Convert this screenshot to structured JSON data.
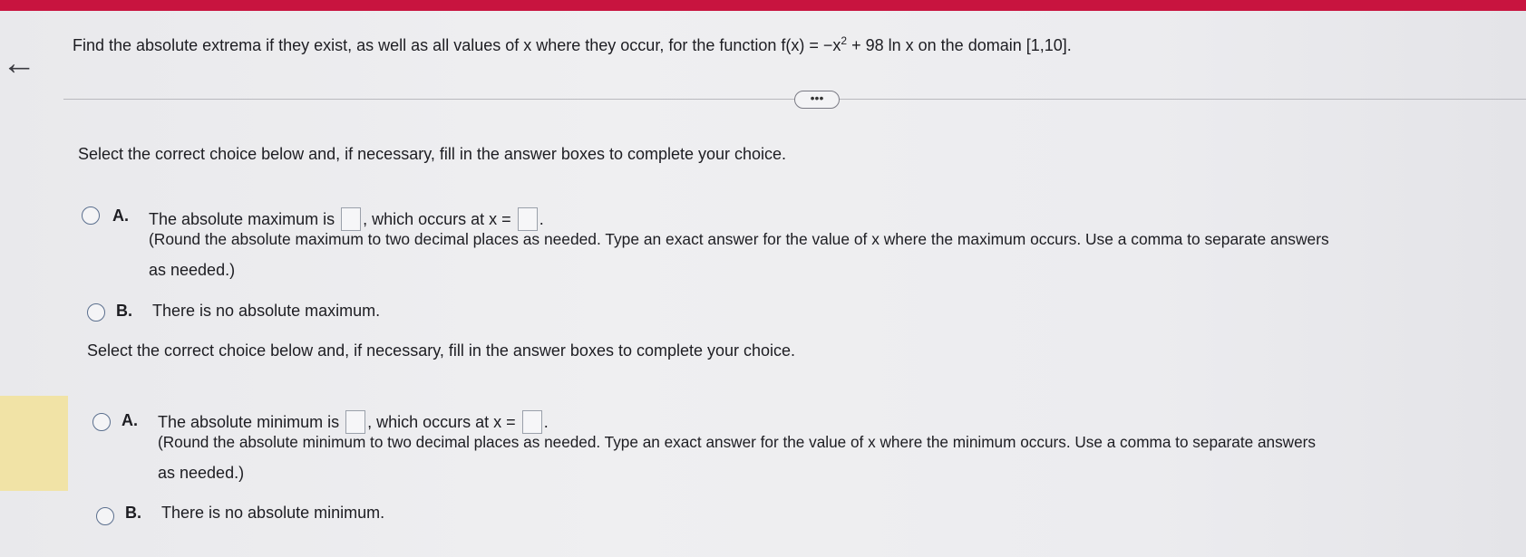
{
  "question": {
    "prefix": "Find the absolute extrema if they exist, as well as all values of x where they occur, for the function f(x) = −x",
    "exponent": "2",
    "suffix": " + 98 ln x on the domain [1,10]."
  },
  "more_button": "•••",
  "back_icon": "←",
  "part1": {
    "instruction": "Select the correct choice below and, if necessary, fill in the answer boxes to complete your choice.",
    "a_letter": "A.",
    "a_text_1": "The absolute maximum is",
    "a_text_2": ", which occurs at x =",
    "a_text_3": ".",
    "a_note_1": "(Round the absolute maximum to two decimal places as needed. Type an exact answer for the value of x where the maximum occurs. Use a comma to separate answers",
    "a_note_2": "as needed.)",
    "b_letter": "B.",
    "b_text": "There is no absolute maximum."
  },
  "part2": {
    "instruction": "Select the correct choice below and, if necessary, fill in the answer boxes to complete your choice.",
    "a_letter": "A.",
    "a_text_1": "The absolute minimum is",
    "a_text_2": ", which occurs at x =",
    "a_text_3": ".",
    "a_note_1": "(Round the absolute minimum to two decimal places as needed. Type an exact answer for the value of x where the minimum occurs. Use a comma to separate answers",
    "a_note_2": "as needed.)",
    "b_letter": "B.",
    "b_text": "There is no absolute minimum."
  },
  "colors": {
    "topbar": "#c8143f",
    "highlight": "#f1e3a6",
    "radio_border": "#5b6f8e"
  }
}
